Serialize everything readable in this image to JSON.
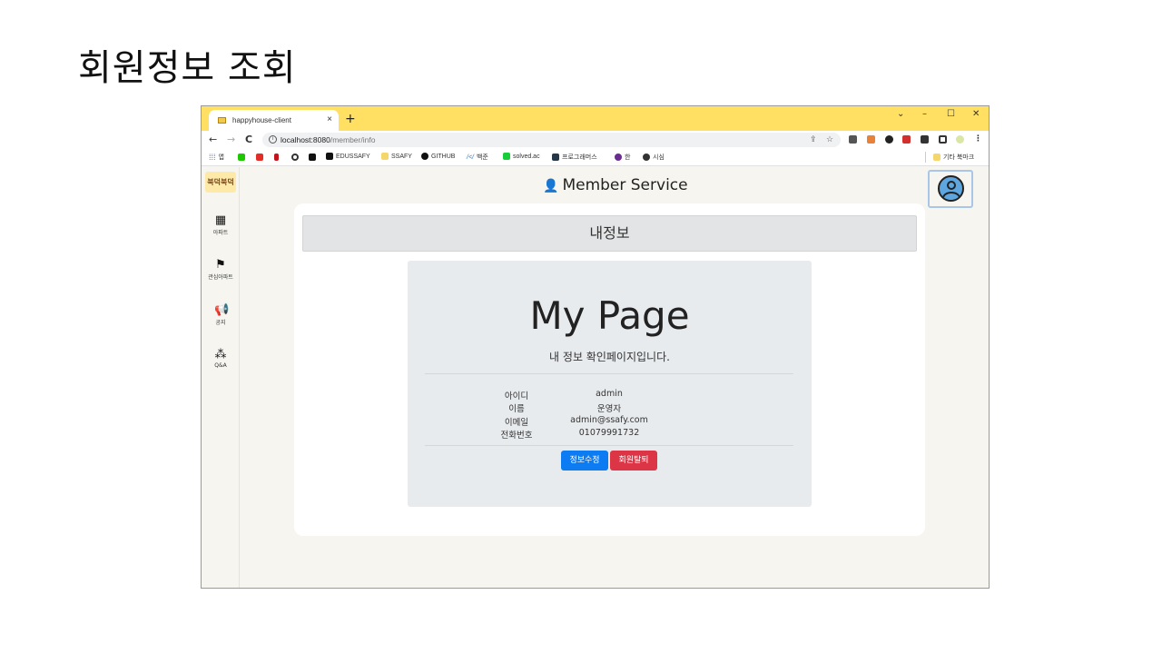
{
  "slide": {
    "title": "회원정보 조회"
  },
  "browser": {
    "tab_title": "happyhouse-client",
    "tab_close": "×",
    "new_tab": "+",
    "controls": {
      "menu": "⌄",
      "minimize": "–",
      "maximize": "☐",
      "close": "✕"
    },
    "nav": {
      "back": "←",
      "forward": "→",
      "reload": "C"
    },
    "url_host": "localhost:8080",
    "url_path": "/member/info",
    "bookmarks": [
      "앱",
      "EDUSSAFY",
      "SSAFY",
      "GITHUB",
      "백준",
      "solved.ac",
      "프로그래머스",
      "한",
      "시심"
    ],
    "other_bookmarks": "기타 북마크"
  },
  "app": {
    "logo": "북덕북덕",
    "sidebar": [
      {
        "label": "아파트",
        "icon": "building-icon"
      },
      {
        "label": "관심아파트",
        "icon": "flag-icon"
      },
      {
        "label": "공지",
        "icon": "megaphone-icon"
      },
      {
        "label": "Q&A",
        "icon": "qa-icon"
      }
    ],
    "header_title": "Member Service",
    "card_header": "내정보",
    "jumbotron": {
      "title": "My Page",
      "lead": "내 정보 확인페이지입니다.",
      "rows": [
        {
          "label": "아이디",
          "value": "admin"
        },
        {
          "label": "이름",
          "value": "운영자"
        },
        {
          "label": "이메일",
          "value": "admin@ssafy.com"
        },
        {
          "label": "전화번호",
          "value": "01079991732"
        }
      ],
      "edit_button": "정보수정",
      "delete_button": "회원탈퇴"
    }
  }
}
